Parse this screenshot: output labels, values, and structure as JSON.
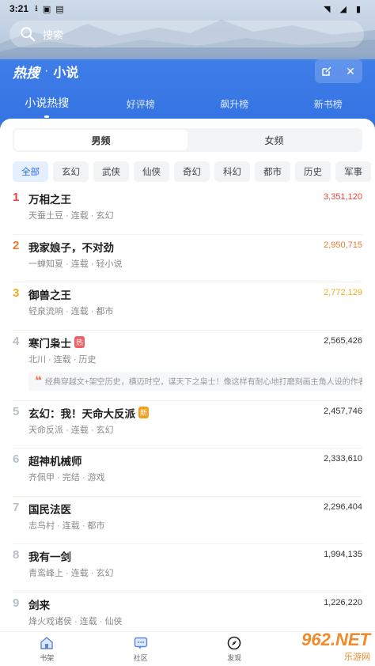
{
  "status": {
    "time": "3:21",
    "icons": [
      "download-icon",
      "a-icon",
      "sim-icon",
      "wifi-icon",
      "signal-icon",
      "battery-icon"
    ]
  },
  "search": {
    "placeholder": "搜索"
  },
  "header": {
    "brand": "热搜",
    "separator": "·",
    "title": "小说"
  },
  "tabs": [
    {
      "label": "小说热搜",
      "active": true
    },
    {
      "label": "好评榜",
      "active": false
    },
    {
      "label": "飙升榜",
      "active": false
    },
    {
      "label": "新书榜",
      "active": false
    }
  ],
  "segment": {
    "male": "男频",
    "female": "女频",
    "selected": "男频"
  },
  "categories": [
    "全部",
    "玄幻",
    "武侠",
    "仙侠",
    "奇幻",
    "科幻",
    "都市",
    "历史",
    "军事"
  ],
  "books": [
    {
      "rank": "1",
      "title": "万相之王",
      "meta": "天蚕土豆 · 连载 · 玄幻",
      "count": "3,351,120",
      "badge": ""
    },
    {
      "rank": "2",
      "title": "我家娘子，不对劲",
      "meta": "一蝉知夏 · 连载 · 轻小说",
      "count": "2,950,715",
      "badge": ""
    },
    {
      "rank": "3",
      "title": "御兽之王",
      "meta": "轻泉流响 · 连载 · 都市",
      "count": "2,772,129",
      "badge": ""
    },
    {
      "rank": "4",
      "title": "寒门枭士",
      "meta": "北川 · 连载 · 历史",
      "count": "2,565,426",
      "badge": "热",
      "quote": "经典穿越文+架空历史，横迈时空，谋天下之枭士！像这样有耐心地打磨刻画主角人设的作者不"
    },
    {
      "rank": "5",
      "title": "玄幻：我！天命大反派",
      "meta": "天命反派 · 连载 · 玄幻",
      "count": "2,457,746",
      "badge": "新"
    },
    {
      "rank": "6",
      "title": "超神机械师",
      "meta": "齐佩甲 · 完结 · 游戏",
      "count": "2,333,610",
      "badge": ""
    },
    {
      "rank": "7",
      "title": "国民法医",
      "meta": "志鸟村 · 连载 · 都市",
      "count": "2,296,404",
      "badge": ""
    },
    {
      "rank": "8",
      "title": "我有一剑",
      "meta": "青鸾峰上 · 连载 · 玄幻",
      "count": "1,994,135",
      "badge": ""
    },
    {
      "rank": "9",
      "title": "剑来",
      "meta": "烽火戏诸侯 · 连载 · 仙侠",
      "count": "1,226,220",
      "badge": ""
    }
  ],
  "bottom_nav": [
    {
      "label": "书架",
      "icon": "bookshelf-icon"
    },
    {
      "label": "社区",
      "icon": "community-icon"
    },
    {
      "label": "发现",
      "icon": "discover-icon"
    }
  ],
  "watermark": {
    "main": "962.NET",
    "sub": "乐游网"
  },
  "colors": {
    "primary": "#2f6fe0",
    "rank1": "#e0463c",
    "rank2": "#ef7a2e",
    "rank3": "#efac22",
    "hot": "#f06060",
    "new": "#f0a020"
  }
}
